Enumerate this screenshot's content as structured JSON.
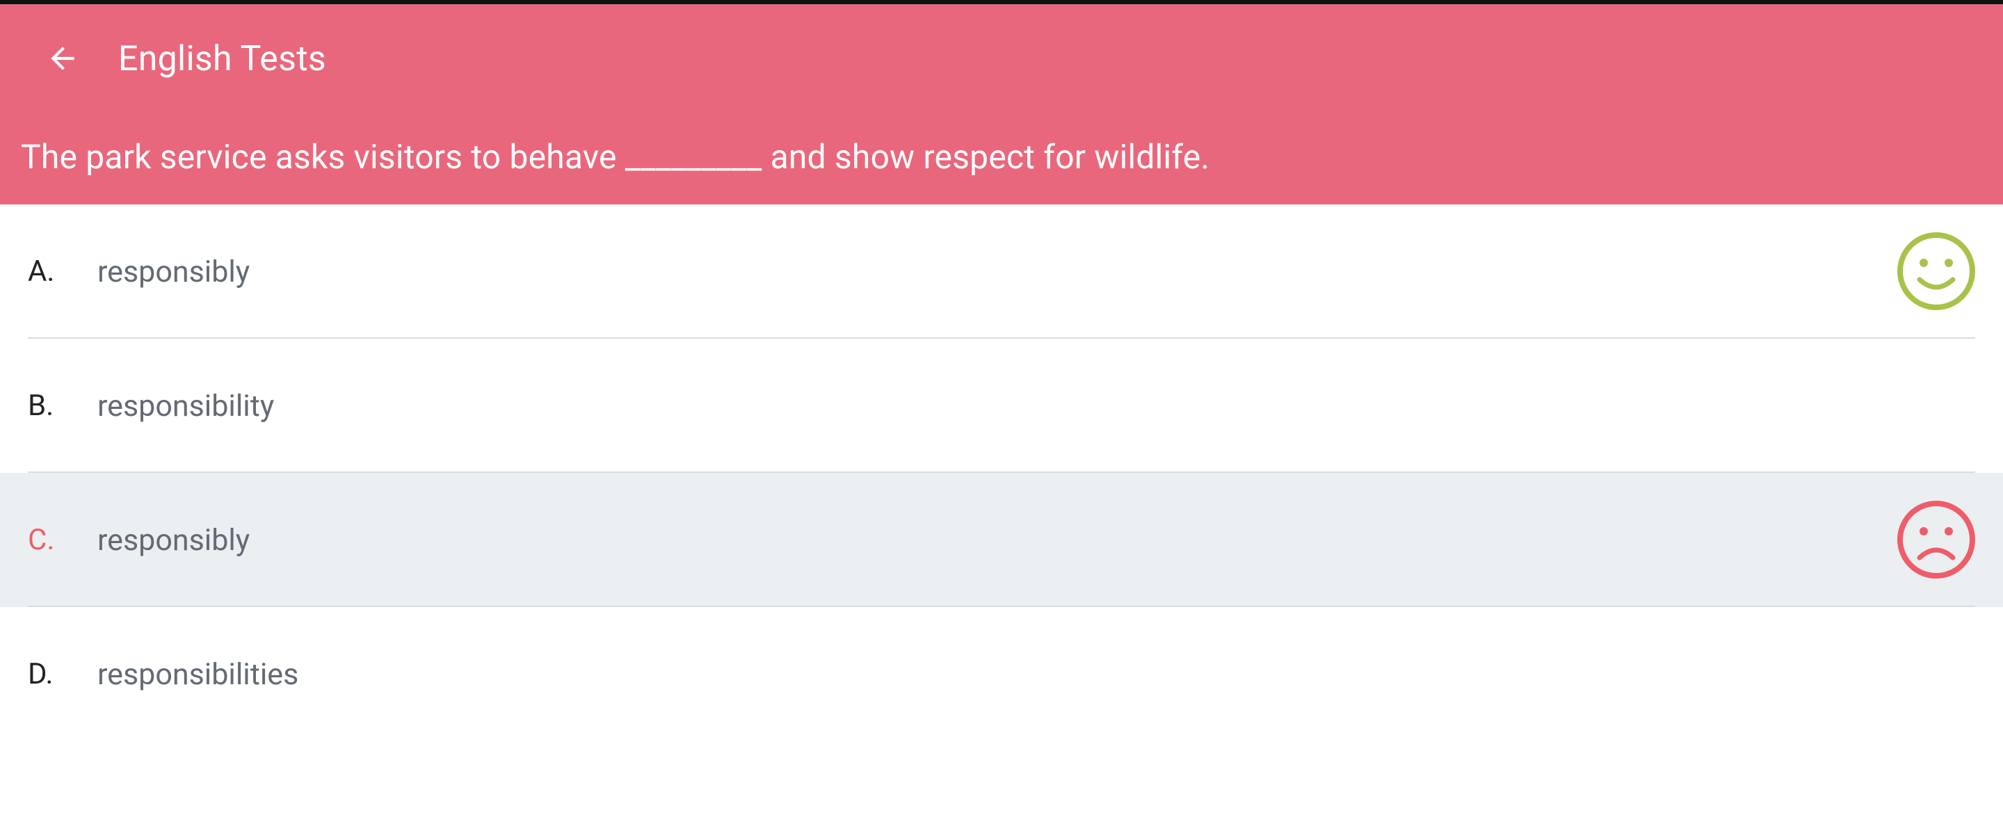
{
  "app": {
    "title": "English Tests",
    "back_icon": "arrow-left-icon"
  },
  "colors": {
    "header_bg": "#e9677c",
    "correct": "#a9c24a",
    "wrong": "#ee5d68",
    "selected_row_bg": "#eceff2"
  },
  "question": {
    "text": "The park service asks visitors to behave _________ and show respect for wildlife."
  },
  "answers": [
    {
      "letter": "A.",
      "text": "responsibly",
      "status": "correct",
      "icon": "smiley-face-icon"
    },
    {
      "letter": "B.",
      "text": "responsibility",
      "status": "none"
    },
    {
      "letter": "C.",
      "text": "responsibly",
      "status": "wrong",
      "icon": "sad-face-icon",
      "selected": true
    },
    {
      "letter": "D.",
      "text": "responsibilities",
      "status": "none"
    }
  ]
}
